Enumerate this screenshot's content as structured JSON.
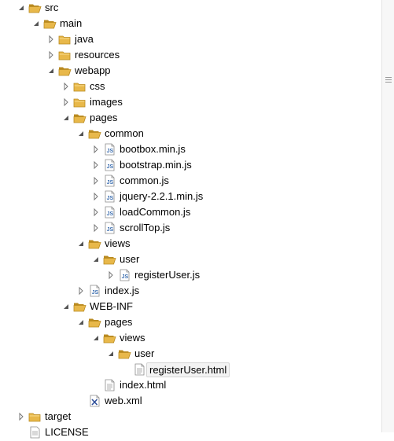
{
  "tree": {
    "items": [
      {
        "label": "src",
        "depth": 0,
        "state": "expanded",
        "icon": "folder-open-icon"
      },
      {
        "label": "main",
        "depth": 1,
        "state": "expanded",
        "icon": "folder-open-icon"
      },
      {
        "label": "java",
        "depth": 2,
        "state": "collapsed",
        "icon": "folder-icon"
      },
      {
        "label": "resources",
        "depth": 2,
        "state": "collapsed",
        "icon": "folder-icon"
      },
      {
        "label": "webapp",
        "depth": 2,
        "state": "expanded",
        "icon": "folder-open-icon"
      },
      {
        "label": "css",
        "depth": 3,
        "state": "collapsed",
        "icon": "folder-icon"
      },
      {
        "label": "images",
        "depth": 3,
        "state": "collapsed",
        "icon": "folder-icon"
      },
      {
        "label": "pages",
        "depth": 3,
        "state": "expanded",
        "icon": "folder-open-icon"
      },
      {
        "label": "common",
        "depth": 4,
        "state": "expanded",
        "icon": "folder-open-icon"
      },
      {
        "label": "bootbox.min.js",
        "depth": 5,
        "state": "collapsed",
        "icon": "js-file-icon"
      },
      {
        "label": "bootstrap.min.js",
        "depth": 5,
        "state": "collapsed",
        "icon": "js-file-icon"
      },
      {
        "label": "common.js",
        "depth": 5,
        "state": "collapsed",
        "icon": "js-file-icon"
      },
      {
        "label": "jquery-2.2.1.min.js",
        "depth": 5,
        "state": "collapsed",
        "icon": "js-file-icon"
      },
      {
        "label": "loadCommon.js",
        "depth": 5,
        "state": "collapsed",
        "icon": "js-file-icon"
      },
      {
        "label": "scrollTop.js",
        "depth": 5,
        "state": "collapsed",
        "icon": "js-file-icon"
      },
      {
        "label": "views",
        "depth": 4,
        "state": "expanded",
        "icon": "folder-open-icon"
      },
      {
        "label": "user",
        "depth": 5,
        "state": "expanded",
        "icon": "folder-open-icon"
      },
      {
        "label": "registerUser.js",
        "depth": 6,
        "state": "collapsed",
        "icon": "js-file-icon"
      },
      {
        "label": "index.js",
        "depth": 4,
        "state": "collapsed",
        "icon": "js-file-icon"
      },
      {
        "label": "WEB-INF",
        "depth": 3,
        "state": "expanded",
        "icon": "folder-open-icon"
      },
      {
        "label": "pages",
        "depth": 4,
        "state": "expanded",
        "icon": "folder-open-icon"
      },
      {
        "label": "views",
        "depth": 5,
        "state": "expanded",
        "icon": "folder-open-icon"
      },
      {
        "label": "user",
        "depth": 6,
        "state": "expanded",
        "icon": "folder-open-icon"
      },
      {
        "label": "registerUser.html",
        "depth": 7,
        "state": "leaf",
        "icon": "html-file-icon",
        "selected": true
      },
      {
        "label": "index.html",
        "depth": 5,
        "state": "leaf",
        "icon": "html-file-icon"
      },
      {
        "label": "web.xml",
        "depth": 4,
        "state": "leaf",
        "icon": "xml-file-icon"
      },
      {
        "label": "target",
        "depth": 0,
        "state": "collapsed",
        "icon": "folder-icon"
      },
      {
        "label": "LICENSE",
        "depth": 0,
        "state": "leaf",
        "icon": "text-file-icon"
      }
    ]
  },
  "colors": {
    "folder": "#e8b84a",
    "folder_dark": "#b98a20",
    "js_blue": "#3d6fb0",
    "xml_blue": "#2f4f9a",
    "selection": "#f3f3f3"
  }
}
